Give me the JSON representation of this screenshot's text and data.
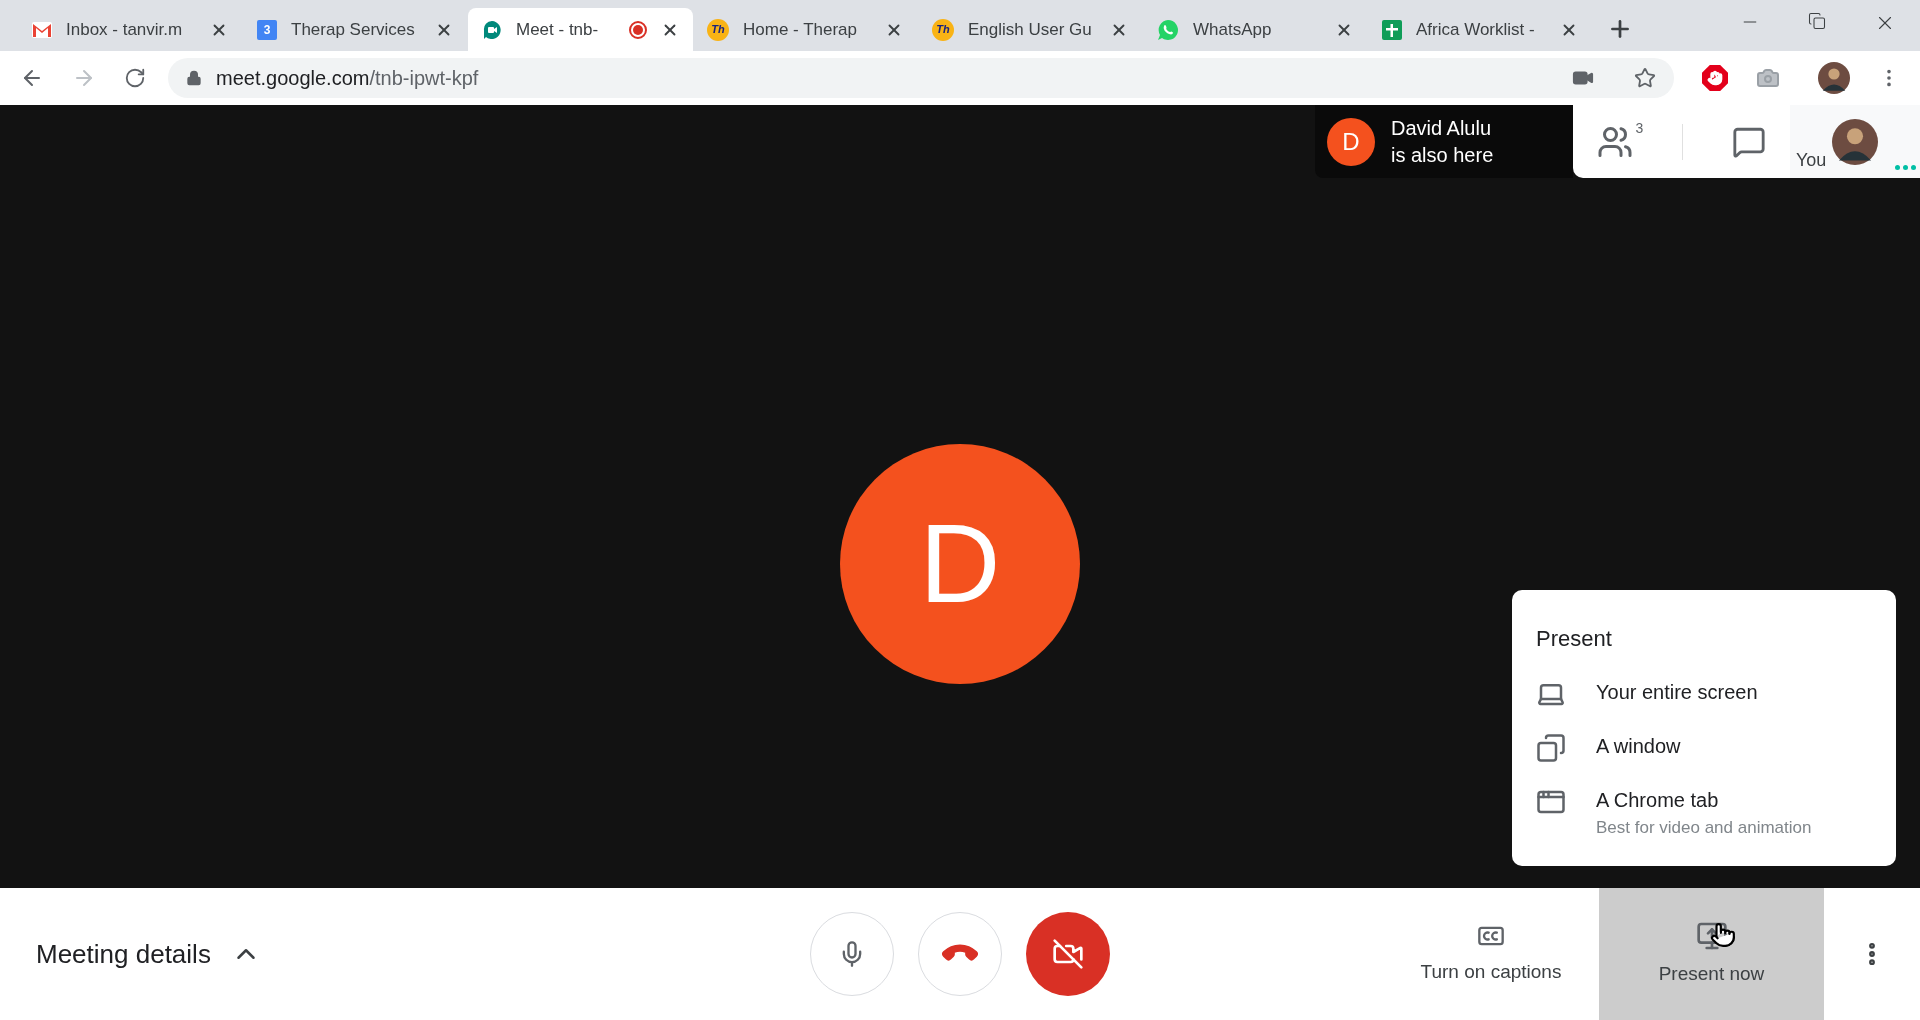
{
  "tabs": [
    {
      "title": "Inbox - tanvir.m",
      "selected": false
    },
    {
      "title": "Therap Services",
      "icon_text": "3",
      "selected": false
    },
    {
      "title": "Meet - tnb-",
      "selected": true,
      "recording": true
    },
    {
      "title": "Home - Therap",
      "icon_text": "Th",
      "selected": false
    },
    {
      "title": "English User Gu",
      "icon_text": "Th",
      "selected": false
    },
    {
      "title": "WhatsApp",
      "selected": false
    },
    {
      "title": "Africa Worklist -",
      "selected": false
    }
  ],
  "address_bar": {
    "host": "meet.google.com",
    "path": "/tnb-ipwt-kpf"
  },
  "notification": {
    "initial": "D",
    "name": "David Alulu",
    "message": "is also here"
  },
  "participants": {
    "count": "3"
  },
  "self_view": {
    "label": "You"
  },
  "main_tile": {
    "initial": "D"
  },
  "present_menu": {
    "title": "Present",
    "items": [
      {
        "kind": "screen",
        "label": "Your entire screen"
      },
      {
        "kind": "window",
        "label": "A window"
      },
      {
        "kind": "tab",
        "label": "A Chrome tab",
        "description": "Best for video and animation"
      }
    ]
  },
  "bottom_bar": {
    "meeting_details": "Meeting details",
    "mic_off": false,
    "camera_off": true,
    "captions": {
      "label": "Turn on captions"
    },
    "present_now": {
      "label": "Present now",
      "active": true
    }
  }
}
